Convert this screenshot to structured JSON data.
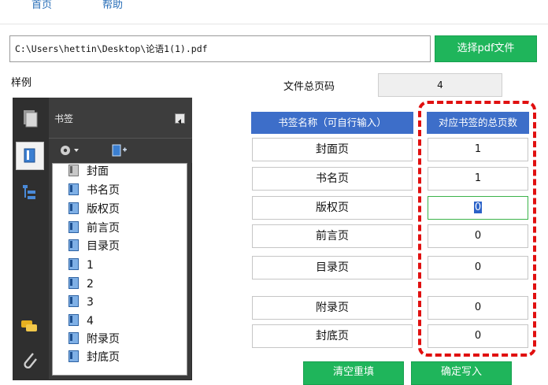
{
  "menu": {
    "items": [
      "首页",
      "帮助"
    ]
  },
  "file": {
    "path": "C:\\Users\\hettin\\Desktop\\论语1(1).pdf",
    "choose_label": "选择pdf文件"
  },
  "sample_label": "样例",
  "total_pages": {
    "label": "文件总页码",
    "value": "4"
  },
  "viewer": {
    "panel_title": "书签",
    "bookmarks": [
      "封面",
      "书名页",
      "版权页",
      "前言页",
      "目录页",
      "1",
      "2",
      "3",
      "4",
      "附录页",
      "封底页"
    ]
  },
  "table": {
    "header_name": "书签名称（可自行输入）",
    "header_page": "对应书签的总页数",
    "rows": [
      {
        "name": "封面页",
        "page": "1"
      },
      {
        "name": "书名页",
        "page": "1"
      },
      {
        "name": "版权页",
        "page": "0"
      },
      {
        "name": "前言页",
        "page": "0"
      },
      {
        "name": "目录页",
        "page": "0"
      },
      {
        "name": "附录页",
        "page": "0"
      },
      {
        "name": "封底页",
        "page": "0"
      }
    ]
  },
  "actions": {
    "clear_label": "清空重填",
    "confirm_label": "确定写入"
  },
  "colors": {
    "green": "#1fb55b",
    "header_blue": "#3d6ec9",
    "highlight_red": "#e01010"
  }
}
